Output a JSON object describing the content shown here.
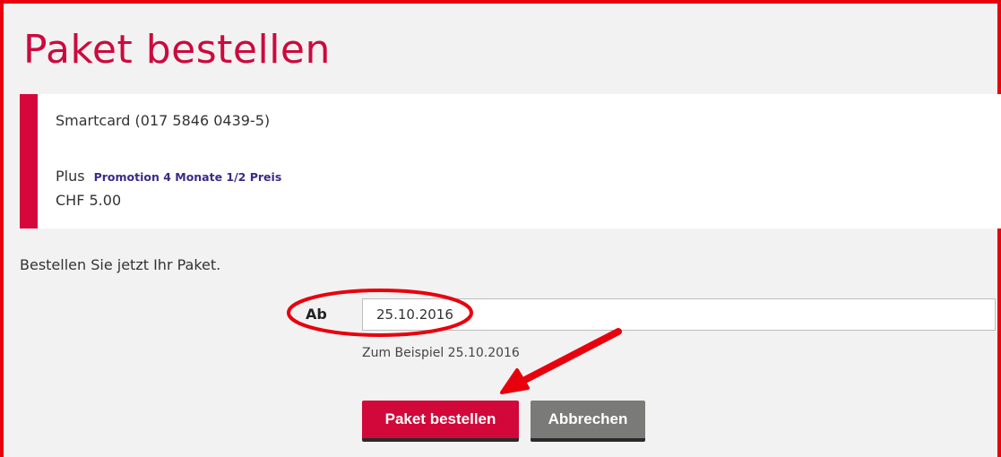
{
  "page": {
    "title": "Paket bestellen"
  },
  "package_card": {
    "smartcard": "Smartcard (017 5846 0439-5)",
    "package_name": "Plus",
    "promotion": "Promotion 4 Monate 1/2 Preis",
    "price": "CHF 5.00"
  },
  "intro_text": "Bestellen Sie jetzt Ihr Paket.",
  "form": {
    "date_label": "Ab",
    "date_value": "25.10.2016",
    "date_hint": "Zum Beispiel 25.10.2016"
  },
  "buttons": {
    "order_label": "Paket bestellen",
    "cancel_label": "Abbrechen"
  },
  "colors": {
    "accent_red": "#d2083a",
    "annotation_red": "#e8000d",
    "promo_purple": "#3b2a87",
    "cancel_gray": "#7a7a78"
  }
}
